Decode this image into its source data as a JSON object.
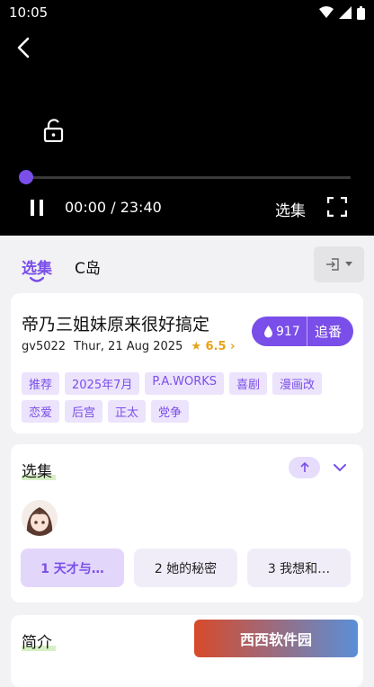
{
  "status_bar": {
    "time": "10:05"
  },
  "player": {
    "current_time": "00:00",
    "separator": "/",
    "duration": "23:40",
    "episodes_label": "选集",
    "progress": 0.0
  },
  "tabs": [
    {
      "label": "选集"
    },
    {
      "label": "C岛"
    }
  ],
  "info": {
    "title": "帝乃三姐妹原来很好搞定",
    "id": "gv5022",
    "date": "Thur, 21 Aug 2025",
    "rating": "6.5",
    "follow_count": "917",
    "follow_label": "追番",
    "tags": [
      "推荐",
      "2025年7月",
      "P.A.WORKS",
      "喜剧",
      "漫画改",
      "恋爱",
      "后宫",
      "正太",
      "党争"
    ]
  },
  "episodes": {
    "title": "选集",
    "items": [
      {
        "label": "1 天才与…"
      },
      {
        "label": "2 她的秘密"
      },
      {
        "label": "3 我想和…"
      }
    ]
  },
  "intro": {
    "title": "简介"
  },
  "watermark": {
    "text": "西西软件园"
  },
  "colors": {
    "accent": "#7a4ee8",
    "rating": "#e7a11a",
    "tag_bg": "#ece3fc"
  }
}
